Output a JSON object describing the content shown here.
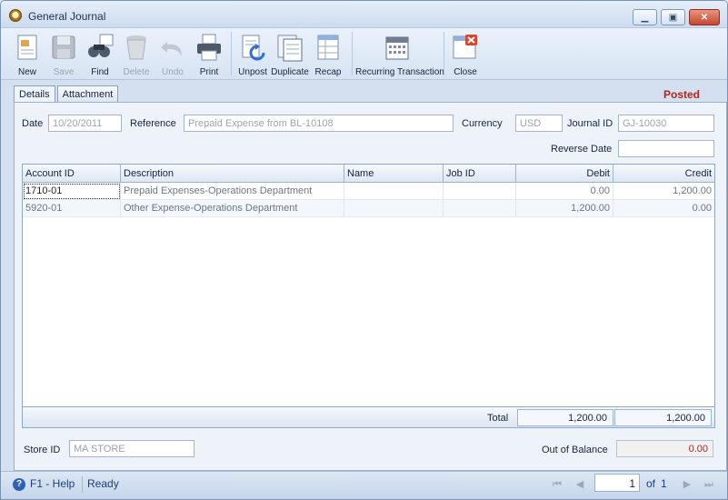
{
  "window": {
    "title": "General Journal",
    "minimize_icon": "minimize-icon",
    "maximize_icon": "maximize-icon",
    "close_icon": "close-icon"
  },
  "toolbar": {
    "new": "New",
    "save": "Save",
    "find": "Find",
    "delete": "Delete",
    "undo": "Undo",
    "print": "Print",
    "unpost": "Unpost",
    "duplicate": "Duplicate",
    "recap": "Recap",
    "recurring": "Recurring Transaction",
    "close": "Close"
  },
  "tabs": {
    "details": "Details",
    "attachment": "Attachment"
  },
  "status": "Posted",
  "form": {
    "date_label": "Date",
    "date_value": "10/20/2011",
    "reference_label": "Reference",
    "reference_value": "Prepaid Expense from BL-10108",
    "currency_label": "Currency",
    "currency_value": "USD",
    "journal_id_label": "Journal ID",
    "journal_id_value": "GJ-10030",
    "reverse_date_label": "Reverse Date",
    "reverse_date_value": ""
  },
  "grid": {
    "columns": {
      "account_id": "Account ID",
      "description": "Description",
      "name": "Name",
      "job_id": "Job ID",
      "debit": "Debit",
      "credit": "Credit"
    },
    "rows": [
      {
        "account_id": "1710-01",
        "description": "Prepaid Expenses-Operations Department",
        "name": "",
        "job_id": "",
        "debit": "0.00",
        "credit": "1,200.00"
      },
      {
        "account_id": "5920-01",
        "description": "Other Expense-Operations Department",
        "name": "",
        "job_id": "",
        "debit": "1,200.00",
        "credit": "0.00"
      }
    ],
    "total_label": "Total",
    "total_debit": "1,200.00",
    "total_credit": "1,200.00"
  },
  "bottom": {
    "store_id_label": "Store ID",
    "store_id_value": "MA STORE",
    "out_of_balance_label": "Out of Balance",
    "out_of_balance_value": "0.00"
  },
  "statusbar": {
    "help": "F1 - Help",
    "ready": "Ready",
    "page": "1",
    "of_label": "of",
    "total_pages": "1"
  },
  "colors": {
    "posted": "#b3261e",
    "accent": "#2e62b8"
  }
}
